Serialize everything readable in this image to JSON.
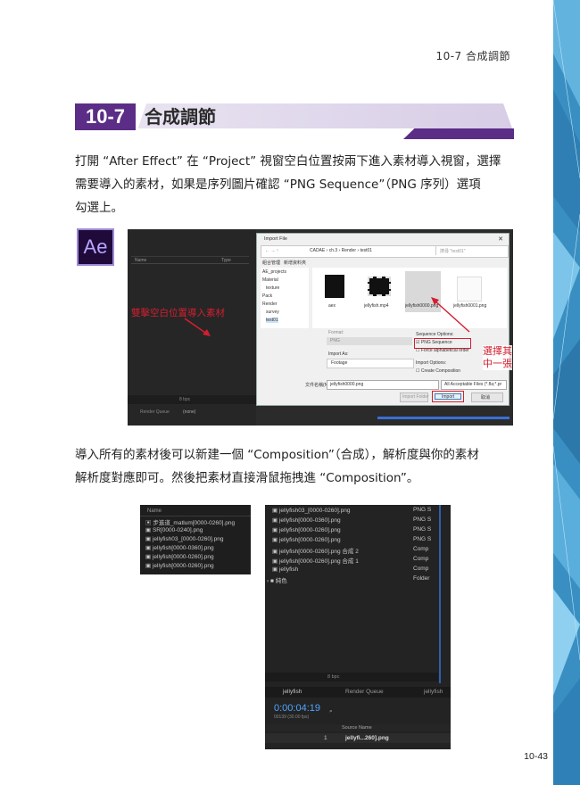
{
  "running_head": "10-7  合成調節",
  "section": {
    "number": "10-7",
    "title": "合成調節"
  },
  "paragraph1": {
    "line1": "打開 “After Effect” 在 “Project” 視窗空白位置按兩下進入素材導入視窗，選擇",
    "line2": "需要導入的素材，如果是序列圖片確認 “PNG Sequence”（PNG 序列）選項",
    "line3": "勾選上。"
  },
  "ae_logo": "Ae",
  "screenshot1": {
    "project_columns": [
      "Name",
      "Type"
    ],
    "annotation_left": "雙擊空白位置導入素材",
    "annotation_right_1": "選擇其",
    "annotation_right_2": "中一張",
    "dialog": {
      "title": "Import File",
      "path": [
        "CADAE",
        "ch.3",
        "Render",
        "test01"
      ],
      "search_placeholder": "搜尋 \"test01\"",
      "toolbar_left": "組合管理",
      "toolbar_new_folder": "新增資料夾",
      "folders": [
        "AE_projects",
        "Material",
        "texture",
        "Pack",
        "Render",
        "survey",
        "test01"
      ],
      "files": [
        "aex",
        "jellyfish.mp4",
        "jellyfish0000.png",
        "jellyfish0001.png"
      ],
      "format_label": "Format:",
      "format_value": "PNG",
      "import_as_label": "Import As:",
      "import_as_value": "Footage",
      "sequence_options_label": "Sequence Options:",
      "png_sequence_label": "PNG Sequence",
      "force_alpha_label": "Force alphabetical order",
      "import_options_label": "Import Options:",
      "create_composition_label": "Create Composition",
      "filename_label": "文件名稱(N):",
      "filename_value": "jellyfish0000.png",
      "filter_value": "All Acceptable Files (*.fla;*.pr",
      "import_folder_label": "Import Folder",
      "import_button": "Import",
      "cancel_button": "取消"
    },
    "bottom_labels": [
      "Render Queue",
      "(none)"
    ],
    "bpc": "8 bpc"
  },
  "paragraph2": {
    "line1": "導入所有的素材後可以新建一個 “Composition”（合成），解析度與你的素材",
    "line2": "解析度對應即可。然後把素材直接滑鼠拖拽進 “Composition”。"
  },
  "screenshot2a": {
    "header": "Name",
    "rows": [
      "步進道_matlum[0000-0260].png",
      "SR[0000-0240].png",
      "jellyfish03_[0000-0260].png",
      "jellyfish[0000-0360].png",
      "jellyfish[0000-0260].png",
      "jellyfish[0000-0260].png"
    ]
  },
  "screenshot2b": {
    "rows": [
      {
        "name": "jellyfish03_[0000-0260].png",
        "type": "PNG S"
      },
      {
        "name": "jellyfish[0000-0360].png",
        "type": "PNG S"
      },
      {
        "name": "jellyfish[0000-0260].png",
        "type": "PNG S"
      },
      {
        "name": "jellyfish[0000-0260].png",
        "type": "PNG S"
      },
      {
        "name": "jellyfish[0000-0260].png 合成 2",
        "type": "Comp"
      },
      {
        "name": "jellyfish[0000-0260].png 合成 1",
        "type": "Comp"
      },
      {
        "name": "jellyfish",
        "type": "Comp"
      },
      {
        "name": "純色",
        "type": "Folder"
      }
    ],
    "bpc": "8 bpc",
    "tab_comp": "jellyfish",
    "tab_render": "Render Queue",
    "tab_right": "jellyfish",
    "timecode": "0:00:04:19",
    "timecode_sub": "00139 (30.00 fps)",
    "layer_header": "Source Name",
    "layer_index": "1",
    "layer_name": "jellyfi...260].png"
  },
  "page_number": "10-43",
  "colors": {
    "section_purple": "#5b2d86",
    "annotation_red": "#d21f2f",
    "strip_blue": "#3f97c8",
    "ae_timecode": "#4ea6ff"
  }
}
